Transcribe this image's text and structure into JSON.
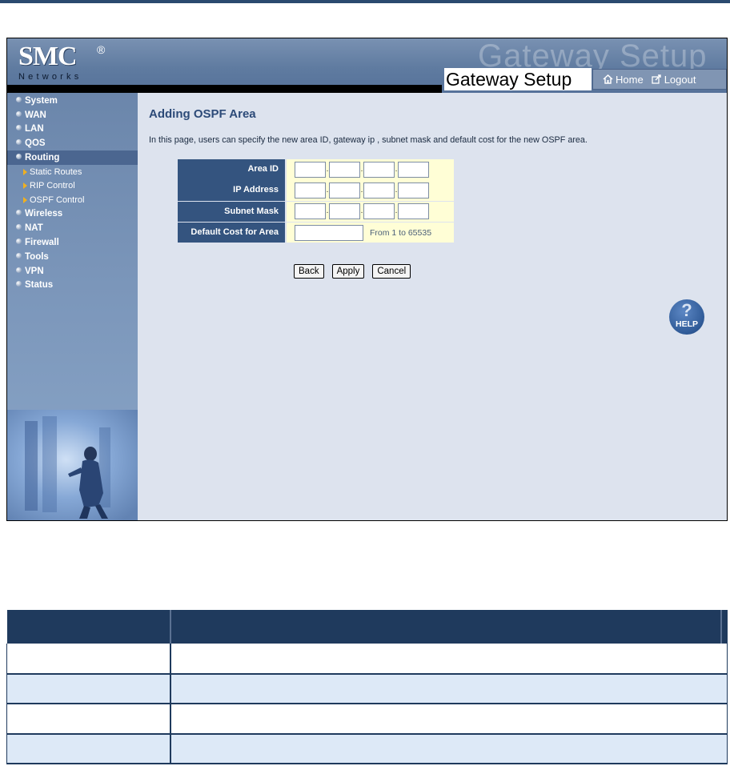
{
  "header": {
    "brand": "SMC",
    "brand_mark": "®",
    "brand_sub": "Networks",
    "ghost_title": "Gateway Setup",
    "title": "Gateway Setup",
    "links": [
      {
        "label": "Home",
        "icon": "home-icon"
      },
      {
        "label": "Logout",
        "icon": "logout-icon"
      }
    ]
  },
  "sidebar": {
    "items": [
      {
        "label": "System"
      },
      {
        "label": "WAN"
      },
      {
        "label": "LAN"
      },
      {
        "label": "QOS"
      },
      {
        "label": "Routing",
        "active": true
      }
    ],
    "submenu": [
      {
        "label": "Static Routes"
      },
      {
        "label": "RIP Control"
      },
      {
        "label": "OSPF Control"
      }
    ],
    "items_after": [
      {
        "label": "Wireless"
      },
      {
        "label": "NAT"
      },
      {
        "label": "Firewall"
      },
      {
        "label": "Tools"
      },
      {
        "label": "VPN"
      },
      {
        "label": "Status"
      }
    ]
  },
  "main": {
    "title": "Adding OSPF Area",
    "description": "In this page, users can specify the new area ID, gateway ip , subnet mask and default cost for the new OSPF area.",
    "fields": {
      "area_id": "Area ID",
      "ip_address": "IP Address",
      "subnet_mask": "Subnet Mask",
      "default_cost": "Default Cost for Area"
    },
    "cost_hint": "From 1 to 65535",
    "buttons": {
      "back": "Back",
      "apply": "Apply",
      "cancel": "Cancel"
    },
    "help": {
      "symbol": "?",
      "label": "HELP"
    }
  },
  "colors": {
    "header": "#5f7ba0",
    "label_bg": "#34547f",
    "field_bg": "#fffed6",
    "title": "#2c4a78",
    "doc_header": "#1f3a5d"
  }
}
